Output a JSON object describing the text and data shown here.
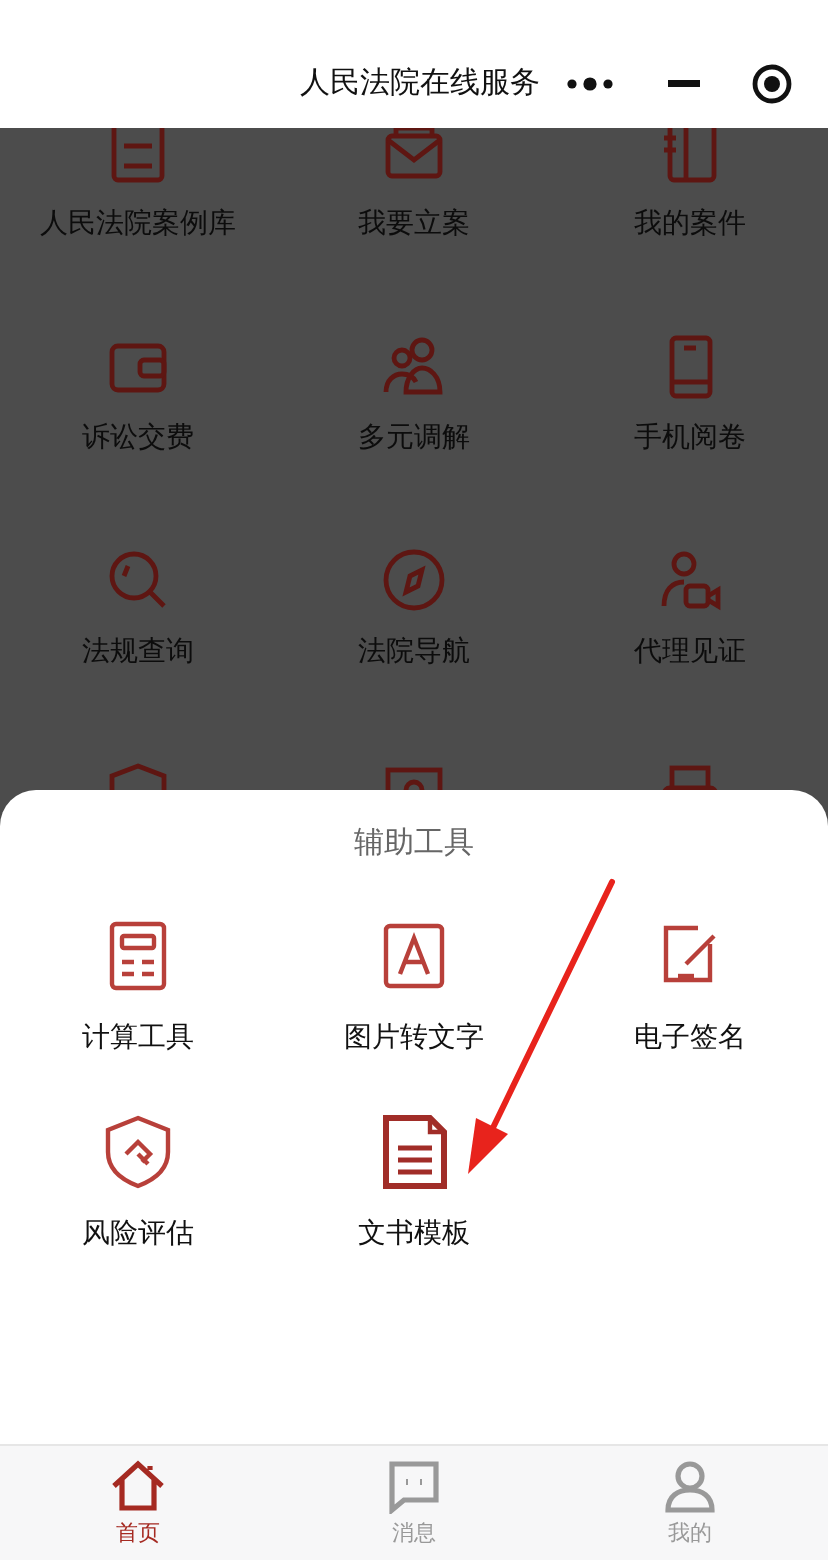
{
  "header": {
    "title": "人民法院在线服务"
  },
  "services": [
    {
      "label": "人民法院案例库"
    },
    {
      "label": "我要立案"
    },
    {
      "label": "我的案件"
    },
    {
      "label": "诉讼交费"
    },
    {
      "label": "多元调解"
    },
    {
      "label": "手机阅卷"
    },
    {
      "label": "法规查询"
    },
    {
      "label": "法院导航"
    },
    {
      "label": "代理见证"
    }
  ],
  "sheet": {
    "title": "辅助工具",
    "tools": [
      {
        "label": "计算工具"
      },
      {
        "label": "图片转文字"
      },
      {
        "label": "电子签名"
      },
      {
        "label": "风险评估"
      },
      {
        "label": "文书模板"
      }
    ]
  },
  "tabs": [
    {
      "label": "首页",
      "selected": true
    },
    {
      "label": "消息",
      "selected": false
    },
    {
      "label": "我的",
      "selected": false
    }
  ]
}
